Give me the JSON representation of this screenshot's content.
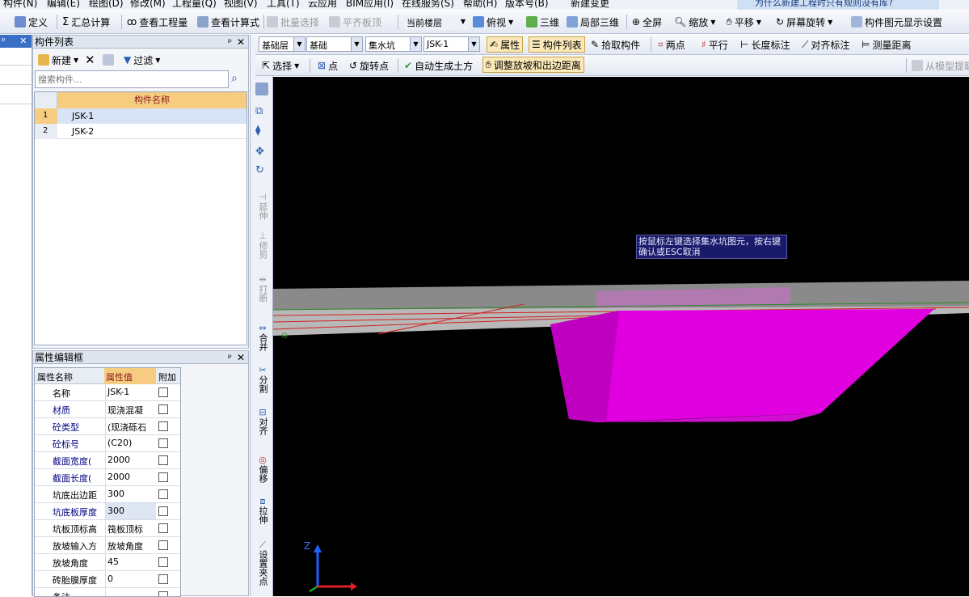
{
  "menu": [
    "构件(N)",
    "编辑(E)",
    "绘图(D)",
    "修改(M)",
    "工程量(Q)",
    "视图(V)",
    "工具(T)",
    "云应用",
    "BIM应用(I)",
    "在线服务(S)",
    "帮助(H)",
    "版本号(B)",
    "新建变更"
  ],
  "banner": "为什么新建工程时只有规则没有库?",
  "toolbar1": {
    "define": "定义",
    "sum": "汇总计算",
    "view_qty": "查看工程量",
    "view_formula": "查看计算式",
    "batch_select": "批量选择",
    "flat_top": "平齐板顶",
    "current_floor": "当前楼层",
    "top_view": "俯视",
    "three_d": "三维",
    "local_3d": "局部三维",
    "fullscreen": "全屏",
    "zoom": "缩放",
    "pan": "平移",
    "screen_rotate": "屏幕旋转",
    "display_settings": "构件图元显示设置"
  },
  "toolbar2": {
    "floor": "基础层",
    "category": "基础",
    "type": "集水坑",
    "component": "JSK-1",
    "attr": "属性",
    "comp_list": "构件列表",
    "pick": "拾取构件",
    "two_point": "两点",
    "parallel": "平行",
    "length_dim": "长度标注",
    "align_dim": "对齐标注",
    "measure": "测量距离"
  },
  "toolbar3": {
    "select": "选择",
    "point": "点",
    "rotate_point": "旋转点",
    "auto_earth": "自动生成土方",
    "adjust_slope": "调整放坡和出边距离",
    "extract": "从模型提取"
  },
  "comp_panel": {
    "title": "构件列表",
    "new": "新建",
    "filter": "过滤",
    "search_placeholder": "搜索构件...",
    "col_name": "构件名称",
    "rows": [
      {
        "idx": "1",
        "name": "JSK-1"
      },
      {
        "idx": "2",
        "name": "JSK-2"
      }
    ]
  },
  "prop_panel": {
    "title": "属性编辑框",
    "col_name": "属性名称",
    "col_value": "属性值",
    "col_extra": "附加",
    "rows": [
      {
        "k": "名称",
        "v": "JSK-1"
      },
      {
        "k": "材质",
        "v": "现浇混凝"
      },
      {
        "k": "砼类型",
        "v": "(现浇砾石"
      },
      {
        "k": "砼标号",
        "v": "(C20)"
      },
      {
        "k": "截面宽度(",
        "v": "2000"
      },
      {
        "k": "截面长度(",
        "v": "2000"
      },
      {
        "k": "坑底出边距",
        "v": "300"
      },
      {
        "k": "坑底板厚度",
        "v": "300"
      },
      {
        "k": "坑板顶标高",
        "v": "筏板顶标"
      },
      {
        "k": "放坡输入方",
        "v": "放坡角度"
      },
      {
        "k": "放坡角度",
        "v": "45"
      },
      {
        "k": "砖胎膜厚度",
        "v": "0"
      },
      {
        "k": "备注",
        "v": ""
      }
    ]
  },
  "vtools": [
    "延伸",
    "修剪",
    "打断",
    "合并",
    "分割",
    "对齐",
    "偏移",
    "拉伸",
    "设置夹点"
  ],
  "tooltip": "按鼠标左键选择集水坑图元，按右键确认或ESC取消",
  "axis": {
    "z": "Z"
  },
  "colors": {
    "viewport_bg": "#000000",
    "pit": "#e000e0",
    "slab": "#8a8a8a",
    "accent": "#f0c070"
  }
}
